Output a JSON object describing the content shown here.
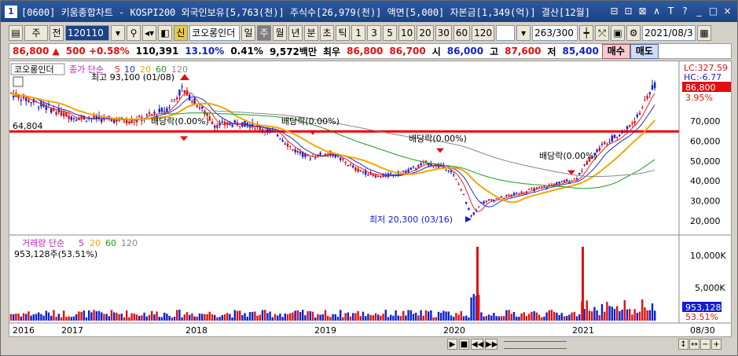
{
  "title": {
    "index": "1",
    "text": "[0600] 키움종합차트 - KOSPI200 외국인보유[5,763(천)] 주식수[26,979(천)] 액면[5,000] 자본금[1,349(억)] 결산[12월]"
  },
  "window_buttons": [
    "⊟",
    "⊡",
    "⊠",
    "∧",
    "T",
    "?",
    "_",
    "□",
    "×"
  ],
  "toolbar": {
    "type_select": "주",
    "prev_label": "전",
    "code": "120110",
    "credit_badge": "신",
    "stock_name": "코오롱인더",
    "periods": [
      "일",
      "주",
      "월",
      "년",
      "분",
      "초",
      "틱"
    ],
    "active_period": "주",
    "intervals": [
      "1",
      "3",
      "5",
      "10",
      "20",
      "30",
      "60",
      "120"
    ],
    "count": "263/300",
    "date": "2021/08/3"
  },
  "info": {
    "price": "86,800",
    "arrow": "▲",
    "change": "500",
    "change_pct": "+0.58%",
    "volume": "110,391",
    "vol_ratio": "13.10%",
    "turnover": "0.41%",
    "amount": "9,572백만",
    "best_label": "최우",
    "ask": "86,800",
    "bid": "86,700",
    "open_label": "시",
    "open": "86,000",
    "high_label": "고",
    "high": "87,600",
    "low_label": "저",
    "low": "85,400",
    "buy_button": "매수",
    "sell_button": "매도"
  },
  "chart": {
    "stock_tag": "코오롱인더",
    "ma_legend": {
      "prefix": "종가 단순",
      "periods": [
        "5",
        "10",
        "20",
        "60",
        "120"
      ],
      "colors": [
        "#ee2222",
        "#2030c0",
        "#f0a800",
        "#1c9a1c",
        "#888888"
      ]
    },
    "high_note": "최고 93,100 (01/08)",
    "low_note": "최저 20,300 (03/16)",
    "hline_label": "64,804",
    "hline_value": 64804,
    "dividend_labels": [
      "배당락(0.00%)",
      "배당락(0.00%)",
      "배당락(0.00%)",
      "배당락(0.00%)"
    ],
    "lc_label": "LC:327.59",
    "hc_label": "HC:-6.77",
    "last_price_tag": "86,800",
    "last_pct_tag": "3.95%",
    "price_ticks": [
      "70,000",
      "60,000",
      "50,000",
      "40,000",
      "30,000",
      "20,000"
    ],
    "volume_legend": {
      "prefix": "거래량 단순",
      "periods": [
        "5",
        "20",
        "60",
        "120"
      ],
      "colors": [
        "#c020c0",
        "#f0a800",
        "#1c9a1c",
        "#888888"
      ]
    },
    "volume_value": "953,128주(53.51%)",
    "volume_ticks": [
      "10,000K",
      "5,000K"
    ],
    "volume_tag": "953,128",
    "volume_pct_tag": "53.51%",
    "x_labels": [
      "2016",
      "2017",
      "2018",
      "2019",
      "2020",
      "2021"
    ],
    "x_right_label": "08/30",
    "colors": {
      "up": "#e01010",
      "down": "#1020d0",
      "hline": "#ee0000"
    }
  },
  "status": {
    "nav_buttons": [
      "▶",
      "■",
      "◀◀",
      "▶▶"
    ],
    "zoom_buttons": [
      "−",
      "+"
    ],
    "extra": [
      "↕",
      "↔"
    ]
  }
}
